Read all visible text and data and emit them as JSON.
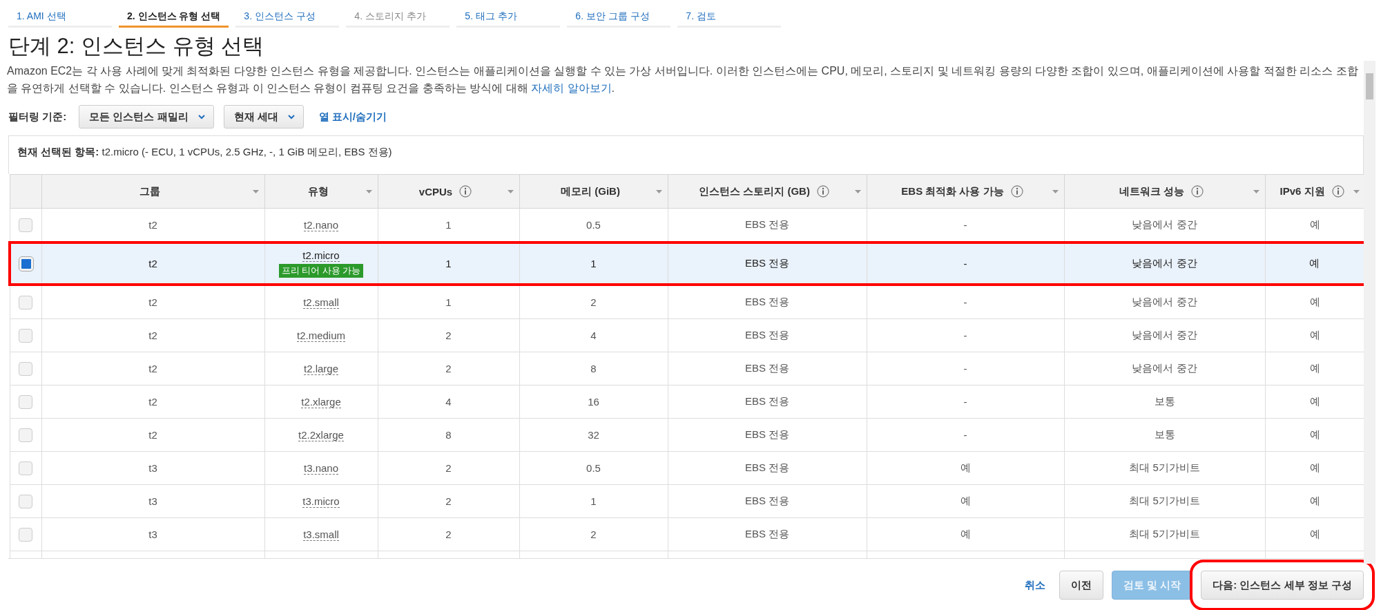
{
  "steps": [
    {
      "label": "1. AMI 선택",
      "selected": false,
      "disabled": false
    },
    {
      "label": "2. 인스턴스 유형 선택",
      "selected": true,
      "disabled": false
    },
    {
      "label": "3. 인스턴스 구성",
      "selected": false,
      "disabled": false
    },
    {
      "label": "4. 스토리지 추가",
      "selected": false,
      "disabled": true
    },
    {
      "label": "5. 태그 추가",
      "selected": false,
      "disabled": false
    },
    {
      "label": "6. 보안 그룹 구성",
      "selected": false,
      "disabled": false
    },
    {
      "label": "7. 검토",
      "selected": false,
      "disabled": false
    }
  ],
  "title": "단계 2: 인스턴스 유형 선택",
  "description": {
    "text": "Amazon EC2는 각 사용 사례에 맞게 최적화된 다양한 인스턴스 유형을 제공합니다. 인스턴스는 애플리케이션을 실행할 수 있는 가상 서버입니다. 이러한 인스턴스에는 CPU, 메모리, 스토리지 및 네트워킹 용량의 다양한 조합이 있으며, 애플리케이션에 사용할 적절한 리소스 조합을 유연하게 선택할 수 있습니다. 인스턴스 유형과 이 인스턴스 유형이 컴퓨팅 요건을 충족하는 방식에 대해",
    "link": "자세히 알아보기",
    "end": "."
  },
  "filter": {
    "label": "필터링 기준:",
    "family": "모든 인스턴스 패밀리",
    "generation": "현재 세대",
    "columns_link": "열 표시/숨기기"
  },
  "current_selection": {
    "label": "현재 선택된 항목:",
    "value": "t2.micro (- ECU, 1 vCPUs, 2.5 GHz, -, 1 GiB 메모리, EBS 전용)"
  },
  "table": {
    "columns": [
      {
        "label": "그룹",
        "info": false
      },
      {
        "label": "유형",
        "info": false
      },
      {
        "label": "vCPUs",
        "info": true
      },
      {
        "label": "메모리 (GiB)",
        "info": false
      },
      {
        "label": "인스턴스 스토리지 (GB)",
        "info": true
      },
      {
        "label": "EBS 최적화 사용 가능",
        "info": true
      },
      {
        "label": "네트워크 성능",
        "info": true
      },
      {
        "label": "IPv6 지원",
        "info": true
      }
    ],
    "rows": [
      {
        "selected": false,
        "highlighted": false,
        "cells": [
          "t2",
          "t2.nano",
          "1",
          "0.5",
          "EBS 전용",
          "-",
          "낮음에서 중간",
          "예"
        ]
      },
      {
        "selected": true,
        "highlighted": true,
        "badge": "프리 티어 사용 가능",
        "cells": [
          "t2",
          "t2.micro",
          "1",
          "1",
          "EBS 전용",
          "-",
          "낮음에서 중간",
          "예"
        ]
      },
      {
        "selected": false,
        "highlighted": false,
        "cells": [
          "t2",
          "t2.small",
          "1",
          "2",
          "EBS 전용",
          "-",
          "낮음에서 중간",
          "예"
        ]
      },
      {
        "selected": false,
        "highlighted": false,
        "cells": [
          "t2",
          "t2.medium",
          "2",
          "4",
          "EBS 전용",
          "-",
          "낮음에서 중간",
          "예"
        ]
      },
      {
        "selected": false,
        "highlighted": false,
        "cells": [
          "t2",
          "t2.large",
          "2",
          "8",
          "EBS 전용",
          "-",
          "낮음에서 중간",
          "예"
        ]
      },
      {
        "selected": false,
        "highlighted": false,
        "cells": [
          "t2",
          "t2.xlarge",
          "4",
          "16",
          "EBS 전용",
          "-",
          "보통",
          "예"
        ]
      },
      {
        "selected": false,
        "highlighted": false,
        "cells": [
          "t2",
          "t2.2xlarge",
          "8",
          "32",
          "EBS 전용",
          "-",
          "보통",
          "예"
        ]
      },
      {
        "selected": false,
        "highlighted": false,
        "cells": [
          "t3",
          "t3.nano",
          "2",
          "0.5",
          "EBS 전용",
          "예",
          "최대 5기가비트",
          "예"
        ]
      },
      {
        "selected": false,
        "highlighted": false,
        "cells": [
          "t3",
          "t3.micro",
          "2",
          "1",
          "EBS 전용",
          "예",
          "최대 5기가비트",
          "예"
        ]
      },
      {
        "selected": false,
        "highlighted": false,
        "cells": [
          "t3",
          "t3.small",
          "2",
          "2",
          "EBS 전용",
          "예",
          "최대 5기가비트",
          "예"
        ]
      }
    ]
  },
  "buttons": [
    {
      "label": "취소",
      "kind": "link",
      "highlighted": false
    },
    {
      "label": "이전",
      "kind": "default",
      "highlighted": false
    },
    {
      "label": "검토 및 시작",
      "kind": "primary",
      "highlighted": false
    },
    {
      "label": "다음: 인스턴스 세부 정보 구성",
      "kind": "default",
      "highlighted": true
    }
  ]
}
